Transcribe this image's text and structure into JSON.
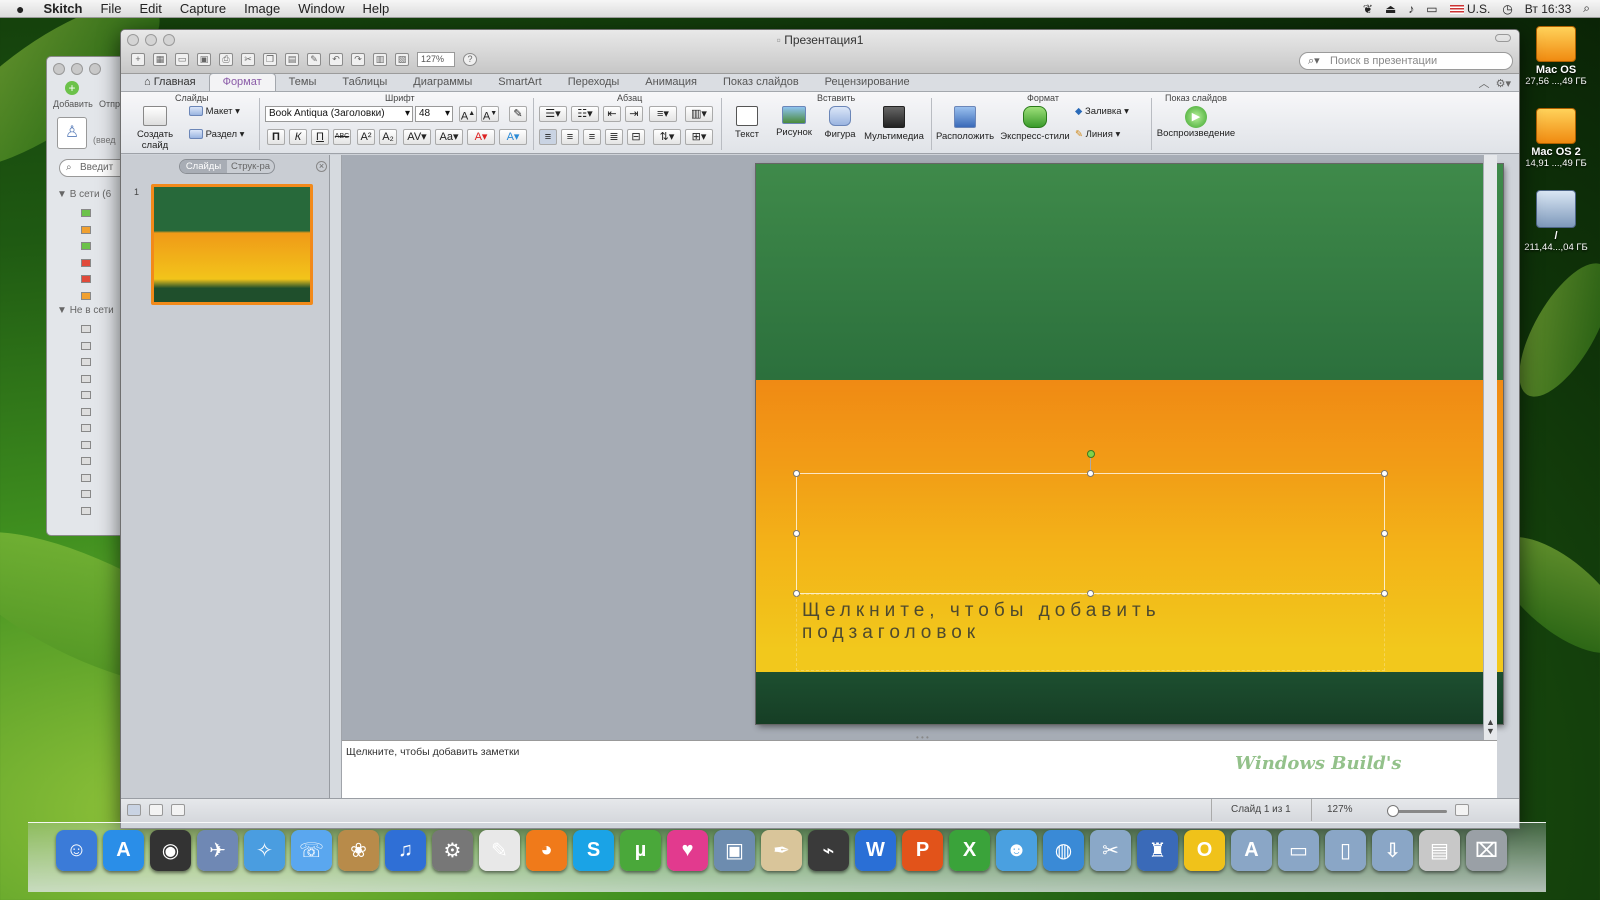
{
  "menubar": {
    "app": "Skitch",
    "items": [
      "File",
      "Edit",
      "Capture",
      "Image",
      "Window",
      "Help"
    ],
    "input_source": "U.S.",
    "clock": "Вт 16:33"
  },
  "skitch_window": {
    "add_label": "Добавить",
    "second_label": "Отпр",
    "search_placeholder": "Введит",
    "group_online": "В сети (6",
    "group_offline": "Не в сети",
    "partial_text": "(введ"
  },
  "ppt": {
    "window_title": "Презентация1",
    "zoom_field": "127%",
    "search_placeholder": "Поиск в презентации",
    "tabs": [
      "Главная",
      "Формат",
      "Темы",
      "Таблицы",
      "Диаграммы",
      "SmartArt",
      "Переходы",
      "Анимация",
      "Показ слайдов",
      "Рецензирование"
    ],
    "active_tab": "Формат",
    "ribbon": {
      "groups": {
        "slides": "Слайды",
        "font": "Шрифт",
        "paragraph": "Абзац",
        "insert": "Вставить",
        "format": "Формат",
        "slideshow": "Показ слайдов"
      },
      "new_slide": "Создать слайд",
      "layout": "Макет",
      "section": "Раздел",
      "font_name": "Book Antiqua (Заголовки)",
      "font_size": "48",
      "bold": "П",
      "italic": "К",
      "underline": "П",
      "strike": "ABC",
      "insert_text": "Текст",
      "insert_picture": "Рисунок",
      "insert_shape": "Фигура",
      "insert_media": "Мультимедиа",
      "arrange": "Расположить",
      "quick_styles": "Экспресс-стили",
      "fill": "Заливка",
      "line": "Линия",
      "play": "Воспроизведение"
    },
    "left_pane": {
      "seg_slides": "Слайды",
      "seg_outline": "Струк-ра",
      "slide_number": "1"
    },
    "slide": {
      "subtitle_placeholder": "Щелкните, чтобы добавить подзаголовок"
    },
    "notes_placeholder": "Щелкните, чтобы добавить заметки",
    "watermark": "Windows Build's",
    "status": {
      "slide_of": "Слайд 1 из 1",
      "zoom": "127%"
    }
  },
  "desktop": [
    {
      "name": "Mac OS",
      "detail": "27,56 ...,49 ГБ"
    },
    {
      "name": "Mac OS 2",
      "detail": "14,91 ...,49 ГБ"
    },
    {
      "name": "/",
      "detail": "211,44...,04 ГБ"
    }
  ],
  "dock": [
    {
      "icon": "finder-icon",
      "glyph": "☺",
      "color": "#3b7bd8"
    },
    {
      "icon": "app-store-icon",
      "glyph": "A",
      "color": "#2a8ee8"
    },
    {
      "icon": "dashboard-icon",
      "glyph": "◉",
      "color": "#333333"
    },
    {
      "icon": "preview-icon",
      "glyph": "✈",
      "color": "#6f88b4"
    },
    {
      "icon": "safari-icon",
      "glyph": "✧",
      "color": "#4a9de0"
    },
    {
      "icon": "ichat-icon",
      "glyph": "☏",
      "color": "#5aa7ef"
    },
    {
      "icon": "iphoto-icon",
      "glyph": "❀",
      "color": "#b88b4a"
    },
    {
      "icon": "itunes-icon",
      "glyph": "♫",
      "color": "#2f6fd6"
    },
    {
      "icon": "system-preferences-icon",
      "glyph": "⚙",
      "color": "#777777"
    },
    {
      "icon": "textedit-icon",
      "glyph": "✎",
      "color": "#e8e8e8"
    },
    {
      "icon": "firefox-icon",
      "glyph": "◕",
      "color": "#f07a1a"
    },
    {
      "icon": "skype-icon",
      "glyph": "S",
      "color": "#1aa3e6"
    },
    {
      "icon": "utorrent-icon",
      "glyph": "µ",
      "color": "#4aa83a"
    },
    {
      "icon": "heart-app-icon",
      "glyph": "♥",
      "color": "#e23a8e"
    },
    {
      "icon": "photo-app-icon",
      "glyph": "▣",
      "color": "#6d8caf"
    },
    {
      "icon": "pen-notes-icon",
      "glyph": "✒",
      "color": "#d9c59a"
    },
    {
      "icon": "grapher-icon",
      "glyph": "⌁",
      "color": "#3a3a3a"
    },
    {
      "icon": "word-icon",
      "glyph": "W",
      "color": "#2a6fd6"
    },
    {
      "icon": "powerpoint-icon",
      "glyph": "P",
      "color": "#e2531a"
    },
    {
      "icon": "excel-icon",
      "glyph": "X",
      "color": "#3aa33a"
    },
    {
      "icon": "messenger-icon",
      "glyph": "☻",
      "color": "#4aa0e0"
    },
    {
      "icon": "network-globe-icon",
      "glyph": "◍",
      "color": "#3a8ad6"
    },
    {
      "icon": "compressor-icon",
      "glyph": "✂",
      "color": "#8aa8c8"
    },
    {
      "icon": "directory-icon",
      "glyph": "♜",
      "color": "#3a6ab8"
    },
    {
      "icon": "opera-icon",
      "glyph": "O",
      "color": "#f0c21a"
    },
    {
      "icon": "applications-folder-icon",
      "glyph": "A",
      "color": "#8aa6c6"
    },
    {
      "icon": "documents-folder-icon",
      "glyph": "▭",
      "color": "#8aa6c6"
    },
    {
      "icon": "files-folder-icon",
      "glyph": "▯",
      "color": "#8aa6c6"
    },
    {
      "icon": "downloads-folder-icon",
      "glyph": "⇩",
      "color": "#8aa6c6"
    },
    {
      "icon": "stack-icon",
      "glyph": "▤",
      "color": "#c8c8c8"
    },
    {
      "icon": "trash-icon",
      "glyph": "⌧",
      "color": "#9aa0a6"
    }
  ]
}
